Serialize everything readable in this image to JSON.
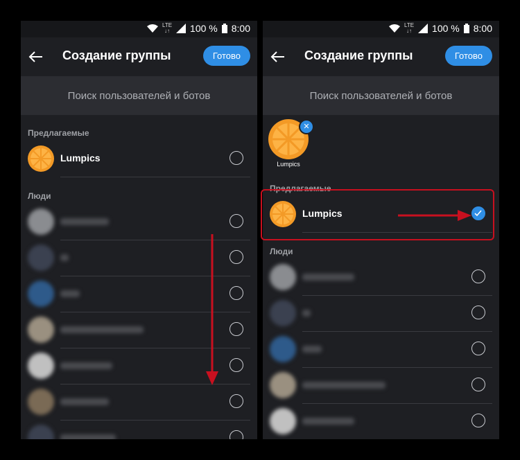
{
  "status": {
    "wifi_icon": "wifi-icon",
    "lte": "LTE",
    "battery": "100 %",
    "time": "8:00"
  },
  "header": {
    "title": "Создание группы",
    "done_label": "Готово"
  },
  "search": {
    "placeholder": "Поиск пользователей и ботов"
  },
  "sections": {
    "suggested": "Предлагаемые",
    "people": "Люди"
  },
  "contact": {
    "name": "Lumpics"
  },
  "selected_chip": {
    "label": "Lumpics"
  },
  "colors": {
    "accent": "#2f8ee5",
    "highlight": "#c8101f",
    "background": "#1e1f23"
  }
}
